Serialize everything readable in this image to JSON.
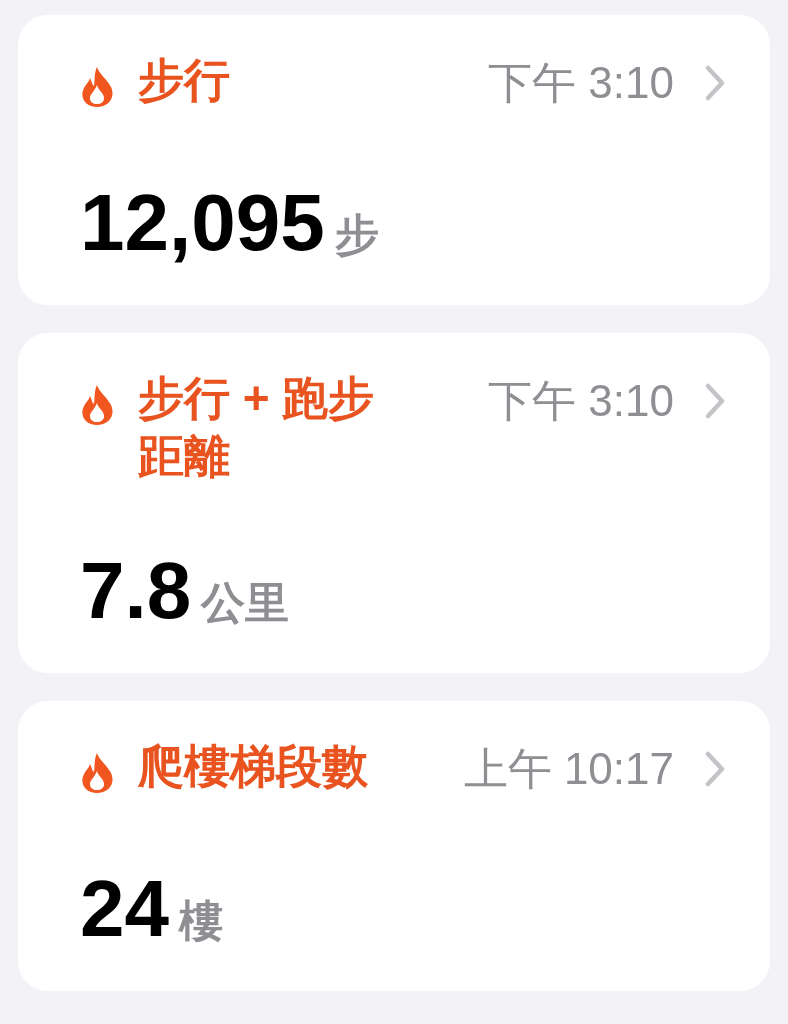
{
  "cards": [
    {
      "title": "步行",
      "time": "下午 3:10",
      "value": "12,095",
      "unit": "步"
    },
    {
      "title": "步行 + 跑步距離",
      "time": "下午 3:10",
      "value": "7.8",
      "unit": "公里"
    },
    {
      "title": "爬樓梯段數",
      "time": "上午 10:17",
      "value": "24",
      "unit": "樓"
    }
  ]
}
